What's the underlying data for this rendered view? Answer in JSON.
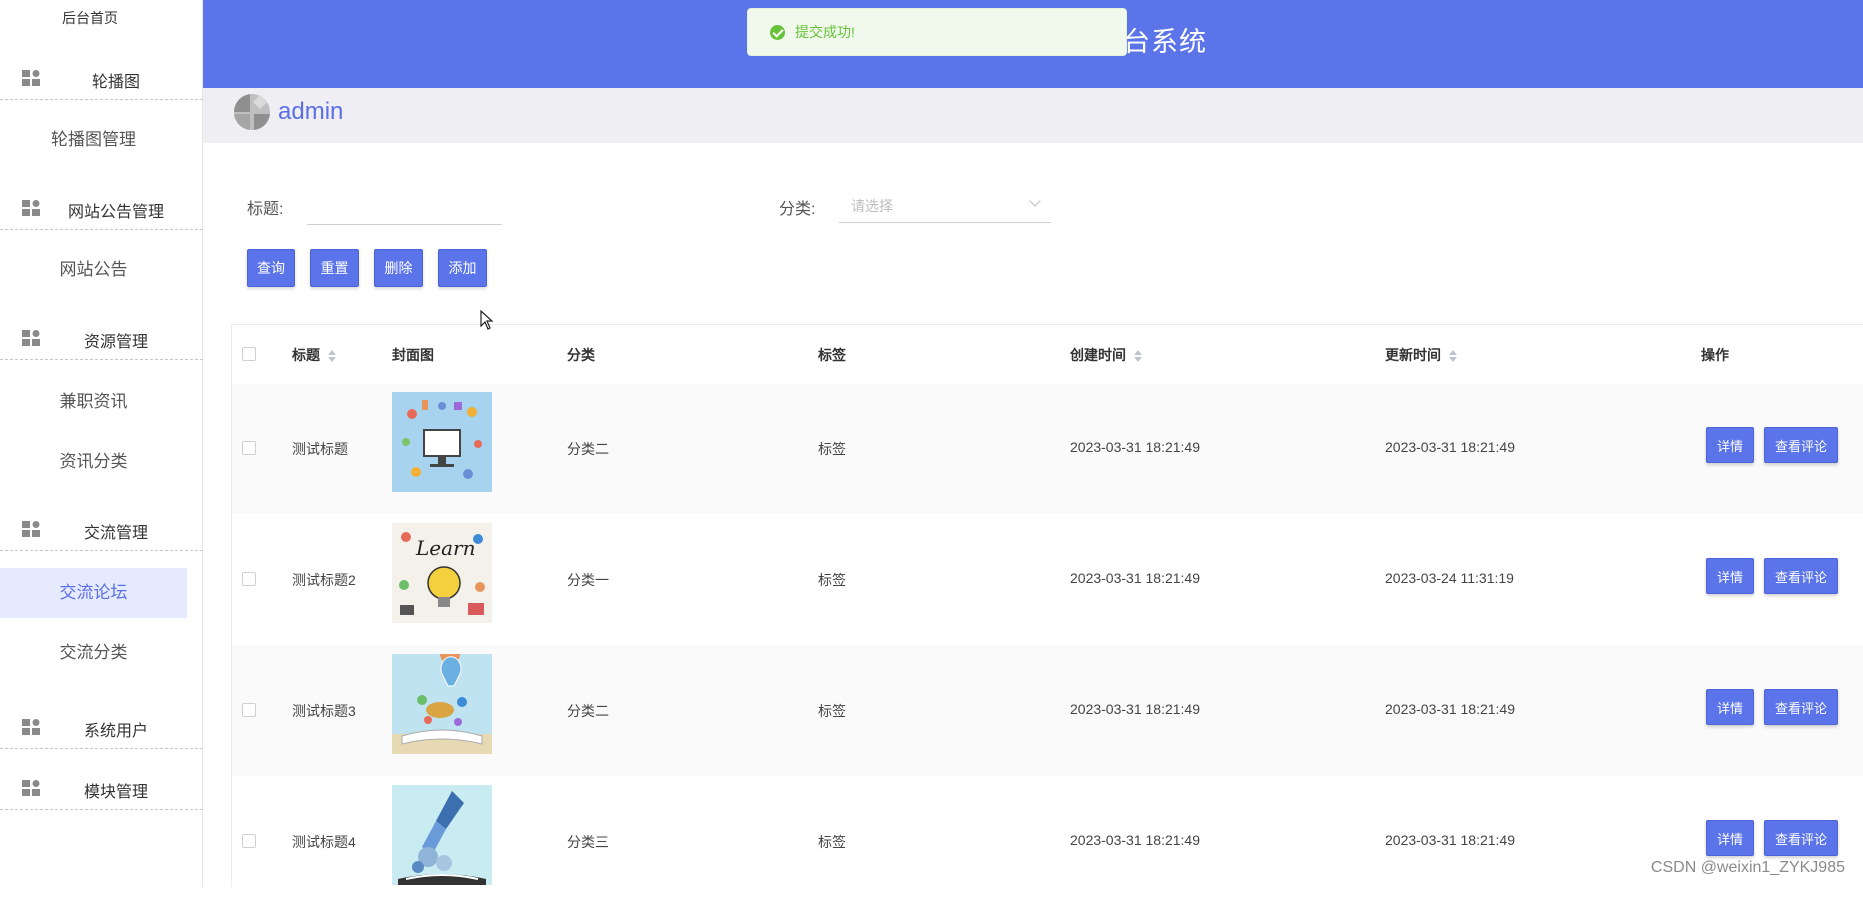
{
  "sidebar": {
    "home": "后台首页",
    "groups": [
      {
        "label": "轮播图",
        "items": [
          "轮播图管理"
        ]
      },
      {
        "label": "网站公告管理",
        "items": [
          "网站公告"
        ]
      },
      {
        "label": "资源管理",
        "items": [
          "兼职资讯",
          "资讯分类"
        ]
      },
      {
        "label": "交流管理",
        "items": [
          "交流论坛",
          "交流分类"
        ]
      },
      {
        "label": "系统用户",
        "items": []
      },
      {
        "label": "模块管理",
        "items": []
      }
    ],
    "active_item": "交流论坛"
  },
  "header": {
    "title": "台系统"
  },
  "toast": {
    "message": "提交成功!",
    "color": "#67c23a"
  },
  "user": {
    "name": "admin"
  },
  "search": {
    "title_label": "标题:",
    "title_value": "",
    "category_label": "分类:",
    "category_placeholder": "请选择"
  },
  "buttons": {
    "query": "查询",
    "reset": "重置",
    "delete": "删除",
    "add": "添加"
  },
  "table": {
    "headers": {
      "title": "标题",
      "cover": "封面图",
      "category": "分类",
      "tag": "标签",
      "created": "创建时间",
      "updated": "更新时间",
      "actions": "操作"
    },
    "rows": [
      {
        "title": "测试标题",
        "category": "分类二",
        "tag": "标签",
        "created": "2023-03-31 18:21:49",
        "updated": "2023-03-31 18:21:49"
      },
      {
        "title": "测试标题2",
        "category": "分类一",
        "tag": "标签",
        "created": "2023-03-31 18:21:49",
        "updated": "2023-03-24 11:31:19"
      },
      {
        "title": "测试标题3",
        "category": "分类二",
        "tag": "标签",
        "created": "2023-03-31 18:21:49",
        "updated": "2023-03-31 18:21:49"
      },
      {
        "title": "测试标题4",
        "category": "分类三",
        "tag": "标签",
        "created": "2023-03-31 18:21:49",
        "updated": "2023-03-31 18:21:49"
      }
    ],
    "detail_label": "详情",
    "comments_label": "查看评论"
  },
  "colors": {
    "accent": "#5b74ea",
    "active_bg": "#e6eaff"
  },
  "watermark": "CSDN @weixin1_ZYKJ985"
}
